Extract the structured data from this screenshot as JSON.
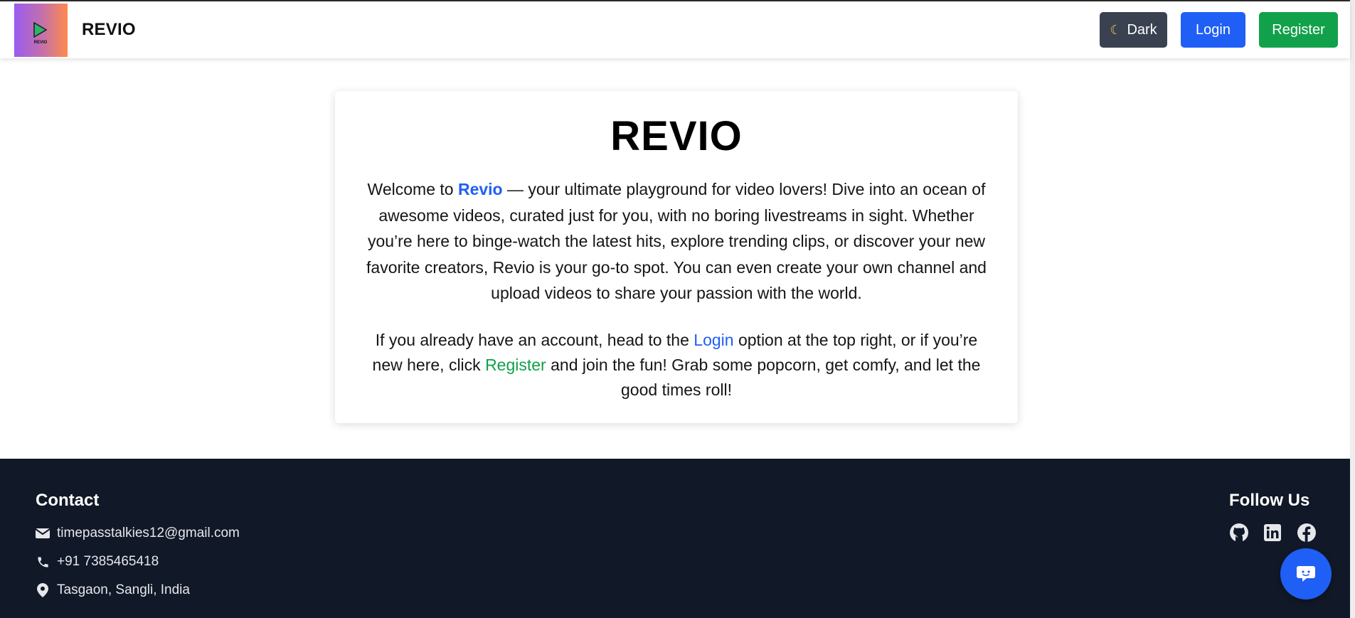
{
  "header": {
    "brand": "REVIO",
    "logo_text": "REVIO",
    "theme_button_label": "Dark",
    "login_label": "Login",
    "register_label": "Register"
  },
  "hero": {
    "title": "REVIO",
    "para1": {
      "before": "Welcome to ",
      "brand_link": "Revio",
      "after": " — your ultimate playground for video lovers! Dive into an ocean of awesome videos, curated just for you, with no boring livestreams in sight. Whether you’re here to binge-watch the latest hits, explore trending clips, or discover your new favorite creators, Revio is your go-to spot. You can even create your own channel and upload videos to share your passion with the world."
    },
    "para2": {
      "before": "If you already have an account, head to the ",
      "login_link": "Login",
      "middle": " option at the top right, or if you’re new here, click ",
      "register_link": "Register",
      "after": " and join the fun! Grab some popcorn, get comfy, and let the good times roll!"
    }
  },
  "footer": {
    "contact_title": "Contact",
    "email": "timepasstalkies12@gmail.com",
    "phone": "+91 7385465418",
    "location": "Tasgaon, Sangli, India",
    "follow_title": "Follow Us",
    "social_icons": [
      "github-icon",
      "linkedin-icon",
      "facebook-icon"
    ]
  },
  "colors": {
    "primary_blue": "#1f5ff5",
    "register_green": "#11a14a",
    "dark_button": "#3a4150",
    "footer_bg": "#111827"
  }
}
